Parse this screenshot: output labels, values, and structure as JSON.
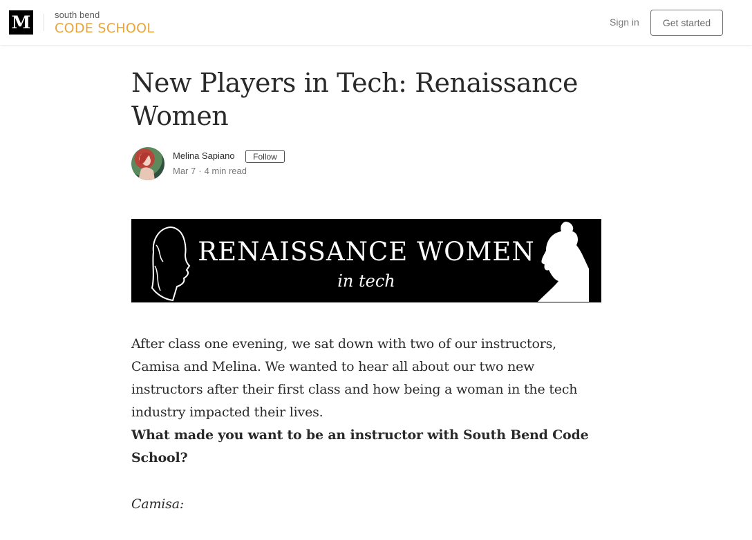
{
  "header": {
    "logo_letter": "M",
    "publication_small": "south bend",
    "publication_big": "CODE SCHOOL",
    "signin_label": "Sign in",
    "get_started_label": "Get started"
  },
  "article": {
    "title": "New Players in Tech: Renaissance Women",
    "author": "Melina Sapiano",
    "follow_label": "Follow",
    "date": "Mar 7",
    "read_time": "4 min read",
    "banner": {
      "title": "RENAISSANCE WOMEN",
      "subtitle": "in tech"
    },
    "paragraphs": [
      "After class one evening, we sat down with two of our instructors, Camisa and Melina. We wanted to hear all about our two new instructors after their first class and how being a woman in the tech industry impacted their lives.",
      "What made you want to be an instructor with South Bend Code School?",
      "Camisa:"
    ]
  },
  "colors": {
    "brand_accent": "#e9a43a",
    "banner_bg": "#000000"
  },
  "icons": {
    "medium_logo": "medium-m-logo",
    "banner_left": "woman-silhouette-left",
    "banner_right": "woman-silhouette-right"
  }
}
